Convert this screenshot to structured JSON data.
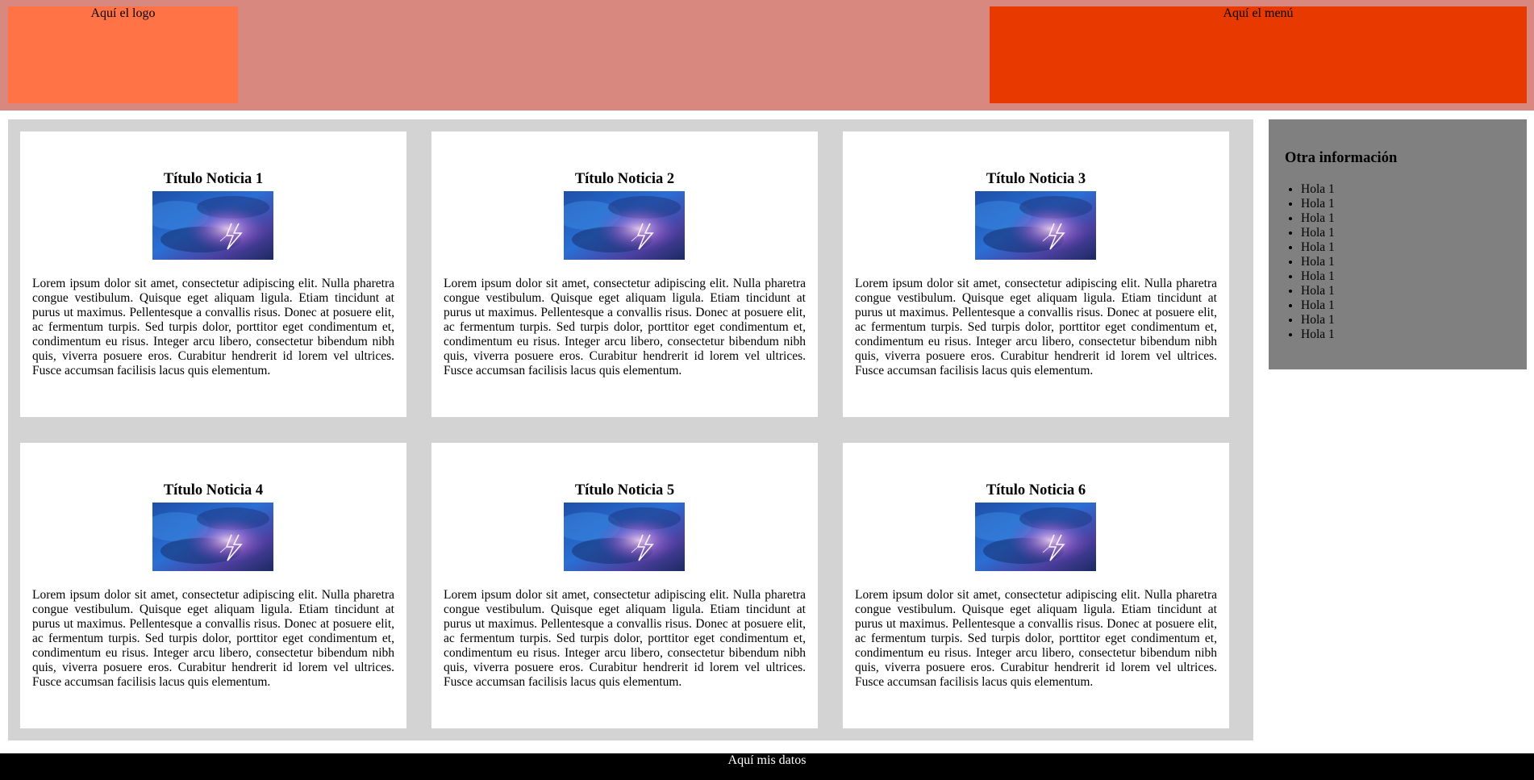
{
  "header": {
    "logo_text": "Aquí el logo",
    "menu_text": "Aquí el menú"
  },
  "news": [
    {
      "title": "Título Noticia 1",
      "image": "storm-lightning-image",
      "body": "Lorem ipsum dolor sit amet, consectetur adipiscing elit. Nulla pharetra congue vestibulum. Quisque eget aliquam ligula. Etiam tincidunt at purus ut maximus. Pellentesque a convallis risus. Donec at posuere elit, ac fermentum turpis. Sed turpis dolor, porttitor eget condimentum et, condimentum eu risus. Integer arcu libero, consectetur bibendum nibh quis, viverra posuere eros. Curabitur hendrerit id lorem vel ultrices. Fusce accumsan facilisis lacus quis elementum."
    },
    {
      "title": "Título Noticia 2",
      "image": "storm-lightning-image",
      "body": "Lorem ipsum dolor sit amet, consectetur adipiscing elit. Nulla pharetra congue vestibulum. Quisque eget aliquam ligula. Etiam tincidunt at purus ut maximus. Pellentesque a convallis risus. Donec at posuere elit, ac fermentum turpis. Sed turpis dolor, porttitor eget condimentum et, condimentum eu risus. Integer arcu libero, consectetur bibendum nibh quis, viverra posuere eros. Curabitur hendrerit id lorem vel ultrices. Fusce accumsan facilisis lacus quis elementum."
    },
    {
      "title": "Título Noticia 3",
      "image": "storm-lightning-image",
      "body": "Lorem ipsum dolor sit amet, consectetur adipiscing elit. Nulla pharetra congue vestibulum. Quisque eget aliquam ligula. Etiam tincidunt at purus ut maximus. Pellentesque a convallis risus. Donec at posuere elit, ac fermentum turpis. Sed turpis dolor, porttitor eget condimentum et, condimentum eu risus. Integer arcu libero, consectetur bibendum nibh quis, viverra posuere eros. Curabitur hendrerit id lorem vel ultrices. Fusce accumsan facilisis lacus quis elementum."
    },
    {
      "title": "Título Noticia 4",
      "image": "storm-lightning-image",
      "body": "Lorem ipsum dolor sit amet, consectetur adipiscing elit. Nulla pharetra congue vestibulum. Quisque eget aliquam ligula. Etiam tincidunt at purus ut maximus. Pellentesque a convallis risus. Donec at posuere elit, ac fermentum turpis. Sed turpis dolor, porttitor eget condimentum et, condimentum eu risus. Integer arcu libero, consectetur bibendum nibh quis, viverra posuere eros. Curabitur hendrerit id lorem vel ultrices. Fusce accumsan facilisis lacus quis elementum."
    },
    {
      "title": "Título Noticia 5",
      "image": "storm-lightning-image",
      "body": "Lorem ipsum dolor sit amet, consectetur adipiscing elit. Nulla pharetra congue vestibulum. Quisque eget aliquam ligula. Etiam tincidunt at purus ut maximus. Pellentesque a convallis risus. Donec at posuere elit, ac fermentum turpis. Sed turpis dolor, porttitor eget condimentum et, condimentum eu risus. Integer arcu libero, consectetur bibendum nibh quis, viverra posuere eros. Curabitur hendrerit id lorem vel ultrices. Fusce accumsan facilisis lacus quis elementum."
    },
    {
      "title": "Título Noticia 6",
      "image": "storm-lightning-image",
      "body": "Lorem ipsum dolor sit amet, consectetur adipiscing elit. Nulla pharetra congue vestibulum. Quisque eget aliquam ligula. Etiam tincidunt at purus ut maximus. Pellentesque a convallis risus. Donec at posuere elit, ac fermentum turpis. Sed turpis dolor, porttitor eget condimentum et, condimentum eu risus. Integer arcu libero, consectetur bibendum nibh quis, viverra posuere eros. Curabitur hendrerit id lorem vel ultrices. Fusce accumsan facilisis lacus quis elementum."
    }
  ],
  "aside": {
    "title": "Otra información",
    "items": [
      "Hola 1",
      "Hola 1",
      "Hola 1",
      "Hola 1",
      "Hola 1",
      "Hola 1",
      "Hola 1",
      "Hola 1",
      "Hola 1",
      "Hola 1",
      "Hola 1"
    ]
  },
  "footer": {
    "text": "Aquí mis datos"
  },
  "colors": {
    "header_bg": "#d98880",
    "logo_bg": "#ff7347",
    "menu_bg": "#e83900",
    "main_bg": "#d3d3d3",
    "aside_bg": "#808080",
    "footer_bg": "#000000"
  }
}
